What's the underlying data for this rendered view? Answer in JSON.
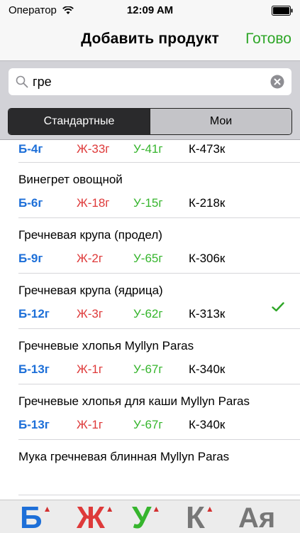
{
  "status": {
    "carrier": "Оператор",
    "time": "12:09 AM"
  },
  "nav": {
    "title": "Добавить продукт",
    "done": "Готово"
  },
  "search": {
    "value": "гре"
  },
  "tabs": {
    "standard": "Стандартные",
    "mine": "Мои"
  },
  "items": [
    {
      "name": "",
      "b": "Б-4г",
      "f": "Ж-33г",
      "c": "У-41г",
      "k": "К-473к"
    },
    {
      "name": "Винегрет овощной",
      "b": "Б-6г",
      "f": "Ж-18г",
      "c": "У-15г",
      "k": "К-218к"
    },
    {
      "name": "Гречневая крупа (продел)",
      "b": "Б-9г",
      "f": "Ж-2г",
      "c": "У-65г",
      "k": "К-306к"
    },
    {
      "name": "Гречневая крупа (ядрица)",
      "b": "Б-12г",
      "f": "Ж-3г",
      "c": "У-62г",
      "k": "К-313к",
      "selected": true
    },
    {
      "name": "Гречневые хлопья Myllyn Paras",
      "b": "Б-13г",
      "f": "Ж-1г",
      "c": "У-67г",
      "k": "К-340к"
    },
    {
      "name": "Гречневые хлопья для каши Myllyn Paras",
      "b": "Б-13г",
      "f": "Ж-1г",
      "c": "У-67г",
      "k": "К-340к"
    },
    {
      "name": "Мука гречневая блинная Myllyn Paras",
      "b": "",
      "f": "",
      "c": "",
      "k": ""
    }
  ],
  "sort_bar": {
    "protein": "Б",
    "fat": "Ж",
    "carbs": "У",
    "calories": "К",
    "alpha": "Ая",
    "arrow": "▲"
  },
  "colors": {
    "done": "#2ea627",
    "protein": "#1d6fd8",
    "fat": "#de3a3a",
    "carbs": "#36b52d",
    "calories": "#000000"
  }
}
